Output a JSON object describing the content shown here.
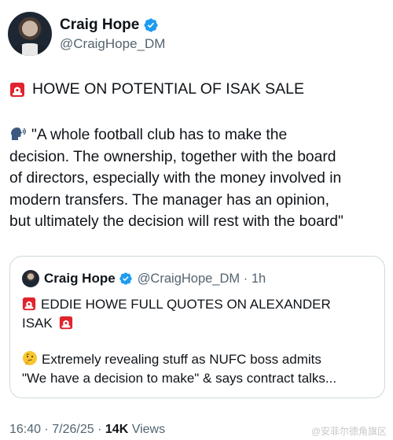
{
  "author": {
    "display_name": "Craig Hope",
    "handle": "@CraigHope_DM",
    "verified": true
  },
  "headline": "HOWE ON POTENTIAL OF ISAK SALE",
  "quote_lines": [
    "\"A whole football club has to make the",
    "decision. The ownership, together with the board",
    "of directors, especially with the money involved in",
    "modern transfers. The manager has an opinion,",
    "but ultimately the decision will rest with the board\""
  ],
  "quoted_tweet": {
    "display_name": "Craig Hope",
    "handle": "@CraigHope_DM",
    "separator": "·",
    "time": "1h",
    "text_line1": "EDDIE HOWE FULL QUOTES ON ALEXANDER",
    "text_line2": "ISAK",
    "text_line3": "Extremely revealing stuff as NUFC boss admits",
    "text_line4": "\"We have a decision to make\" & says contract talks..."
  },
  "meta": {
    "time": "16:40",
    "separator": "·",
    "date": "7/26/25",
    "views_count": "14K",
    "views_label": "Views"
  },
  "watermark": "@安菲尔德角旗区",
  "icons": {
    "verified": "verified-badge-icon",
    "siren": "police-siren-emoji",
    "speaking": "speaking-head-emoji",
    "thinking": "thinking-face-emoji"
  },
  "colors": {
    "verified_blue": "#1d9bf0",
    "text_primary": "#0f1419",
    "text_secondary": "#536471",
    "border": "#cfd9de"
  }
}
